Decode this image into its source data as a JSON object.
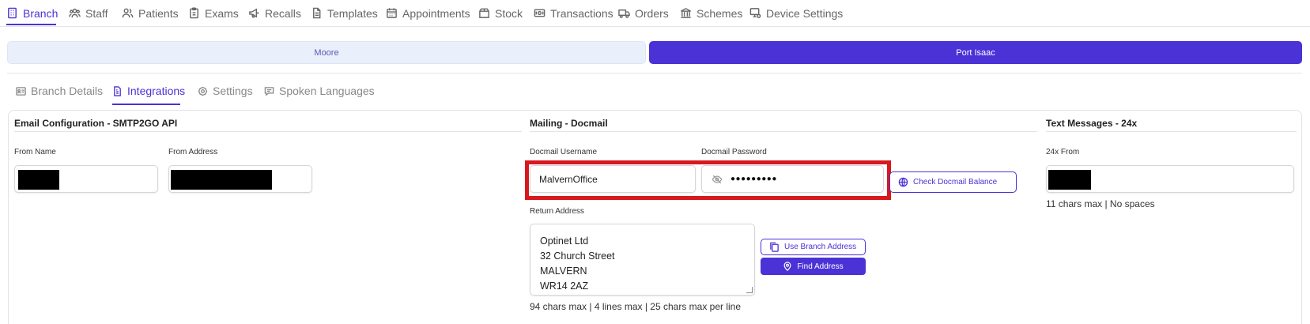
{
  "topnav": {
    "items": [
      {
        "label": "Branch",
        "icon": "building-icon"
      },
      {
        "label": "Staff",
        "icon": "staff-icon"
      },
      {
        "label": "Patients",
        "icon": "users-icon"
      },
      {
        "label": "Exams",
        "icon": "clipboard-icon"
      },
      {
        "label": "Recalls",
        "icon": "megaphone-icon"
      },
      {
        "label": "Templates",
        "icon": "document-icon"
      },
      {
        "label": "Appointments",
        "icon": "calendar-icon"
      },
      {
        "label": "Stock",
        "icon": "box-icon"
      },
      {
        "label": "Transactions",
        "icon": "money-icon"
      },
      {
        "label": "Orders",
        "icon": "truck-icon"
      },
      {
        "label": "Schemes",
        "icon": "bank-icon"
      },
      {
        "label": "Device Settings",
        "icon": "device-settings-icon"
      }
    ],
    "active": "Branch"
  },
  "branches": {
    "moore": "Moore",
    "port_isaac": "Port Isaac",
    "selected": "Port Isaac"
  },
  "subtabs": {
    "items": [
      {
        "label": "Branch Details",
        "icon": "id-card-icon"
      },
      {
        "label": "Integrations",
        "icon": "integration-icon"
      },
      {
        "label": "Settings",
        "icon": "gear-icon"
      },
      {
        "label": "Spoken Languages",
        "icon": "speech-icon"
      }
    ],
    "active": "Integrations"
  },
  "email": {
    "title": "Email Configuration - SMTP2GO API",
    "from_name_label": "From Name",
    "from_address_label": "From Address"
  },
  "mailing": {
    "title": "Mailing - Docmail",
    "username_label": "Docmail Username",
    "username_value": "MalvernOffice",
    "password_label": "Docmail Password",
    "password_value": "●●●●●●●●●",
    "check_balance_button": "Check Docmail Balance",
    "return_address_label": "Return Address",
    "return_address_lines": [
      "Optinet Ltd",
      "32 Church Street",
      "MALVERN",
      "WR14 2AZ"
    ],
    "use_branch_address_button": "Use Branch Address",
    "find_address_button": "Find Address",
    "address_hint": "94 chars max | 4 lines max | 25 chars max per line"
  },
  "text_messages": {
    "title": "Text Messages - 24x",
    "from_label": "24x From",
    "hint": "11 chars max | No spaces"
  },
  "colors": {
    "accent": "#4a32d6",
    "highlight": "#d8181f",
    "switch_inactive_bg": "#eaf0fb"
  }
}
